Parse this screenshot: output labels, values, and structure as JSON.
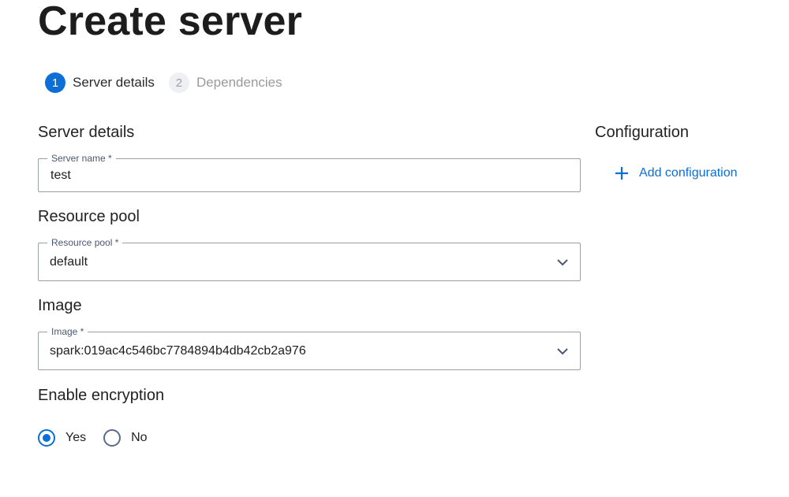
{
  "page": {
    "title": "Create server"
  },
  "stepper": {
    "steps": [
      {
        "number": "1",
        "label": "Server details",
        "state": "active"
      },
      {
        "number": "2",
        "label": "Dependencies",
        "state": "inactive"
      }
    ]
  },
  "server_details": {
    "section_title": "Server details",
    "server_name": {
      "label": "Server name *",
      "value": "test"
    }
  },
  "resource_pool": {
    "section_title": "Resource pool",
    "field": {
      "label": "Resource pool *",
      "value": "default"
    }
  },
  "image": {
    "section_title": "Image",
    "field": {
      "label": "Image *",
      "value": "spark:019ac4c546bc7784894b4db42cb2a976"
    }
  },
  "encryption": {
    "section_title": "Enable encryption",
    "options": [
      {
        "label": "Yes",
        "checked": true
      },
      {
        "label": "No",
        "checked": false
      }
    ]
  },
  "configuration": {
    "section_title": "Configuration",
    "add_label": "Add configuration",
    "add_icon": "plus-icon"
  },
  "colors": {
    "accent": "#0b6fd6",
    "border": "#9aa0aa",
    "field_label": "#4a5872"
  }
}
